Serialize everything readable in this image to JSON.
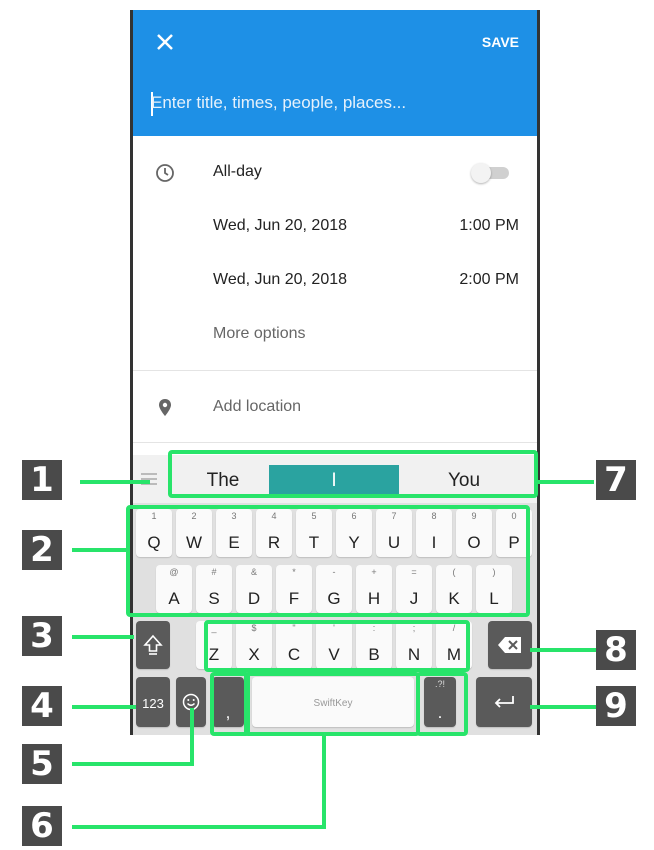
{
  "appbar": {
    "close_icon": "close-icon",
    "save_label": "SAVE",
    "title_placeholder": "Enter title, times, people, places..."
  },
  "rows": {
    "allday_label": "All-day",
    "start_date": "Wed, Jun 20, 2018",
    "start_time": "1:00 PM",
    "end_date": "Wed, Jun 20, 2018",
    "end_time": "2:00 PM",
    "more_options": "More options",
    "add_location": "Add location"
  },
  "keyboard": {
    "suggestions": [
      "The",
      "I",
      "You"
    ],
    "row1": [
      {
        "main": "Q",
        "hint": "1"
      },
      {
        "main": "W",
        "hint": "2"
      },
      {
        "main": "E",
        "hint": "3"
      },
      {
        "main": "R",
        "hint": "4"
      },
      {
        "main": "T",
        "hint": "5"
      },
      {
        "main": "Y",
        "hint": "6"
      },
      {
        "main": "U",
        "hint": "7"
      },
      {
        "main": "I",
        "hint": "8"
      },
      {
        "main": "O",
        "hint": "9"
      },
      {
        "main": "P",
        "hint": "0"
      }
    ],
    "row2": [
      {
        "main": "A",
        "hint": "@"
      },
      {
        "main": "S",
        "hint": "#"
      },
      {
        "main": "D",
        "hint": "&"
      },
      {
        "main": "F",
        "hint": "*"
      },
      {
        "main": "G",
        "hint": "-"
      },
      {
        "main": "H",
        "hint": "+"
      },
      {
        "main": "J",
        "hint": "="
      },
      {
        "main": "K",
        "hint": "("
      },
      {
        "main": "L",
        "hint": ")"
      }
    ],
    "row3": [
      {
        "main": "Z",
        "hint": "_"
      },
      {
        "main": "X",
        "hint": "$"
      },
      {
        "main": "C",
        "hint": "\""
      },
      {
        "main": "V",
        "hint": "'"
      },
      {
        "main": "B",
        "hint": ":"
      },
      {
        "main": "N",
        "hint": ";"
      },
      {
        "main": "M",
        "hint": "/"
      }
    ],
    "num_key": "123",
    "comma_key": ",",
    "space_brand": "SwiftKey",
    "period_key": ".",
    "period_hint": ".?!"
  },
  "callouts": [
    "1",
    "2",
    "3",
    "4",
    "5",
    "6",
    "7",
    "8",
    "9"
  ],
  "colors": {
    "appbar": "#1e90e6",
    "suggestion_highlight": "#2aa3a0",
    "callout_green": "#28e46a",
    "callout_badge": "#4a4a4a"
  }
}
